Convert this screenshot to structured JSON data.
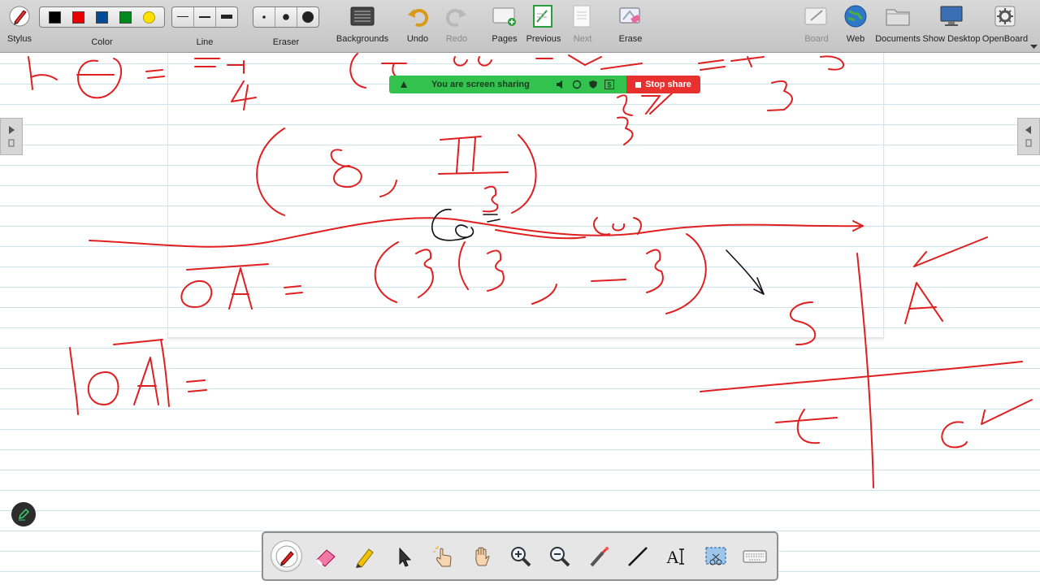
{
  "toolbar": {
    "stylus": "Stylus",
    "color": "Color",
    "line": "Line",
    "eraser": "Eraser",
    "backgrounds": "Backgrounds",
    "undo": "Undo",
    "redo": "Redo",
    "pages": "Pages",
    "previous": "Previous",
    "next": "Next",
    "erase": "Erase",
    "board": "Board",
    "web": "Web",
    "documents": "Documents",
    "show_desktop": "Show Desktop",
    "openboard": "OpenBoard",
    "palette_colors": [
      "#000000",
      "#e60000",
      "#004b9a",
      "#008a1e",
      "#ffe100"
    ]
  },
  "share_banner": {
    "message": "You are screen sharing",
    "stop_label": "Stop share",
    "bar_color": "#33c24d",
    "stop_color": "#e8302e"
  },
  "ink": {
    "red": "#e02020",
    "black": "#111111"
  },
  "dock": {
    "tools": [
      "pen",
      "eraser",
      "highlighter",
      "selector",
      "laser-pointer",
      "hand",
      "zoom-in",
      "zoom-out",
      "pointer",
      "line",
      "text",
      "capture",
      "keyboard"
    ],
    "active_tool": "pen"
  }
}
